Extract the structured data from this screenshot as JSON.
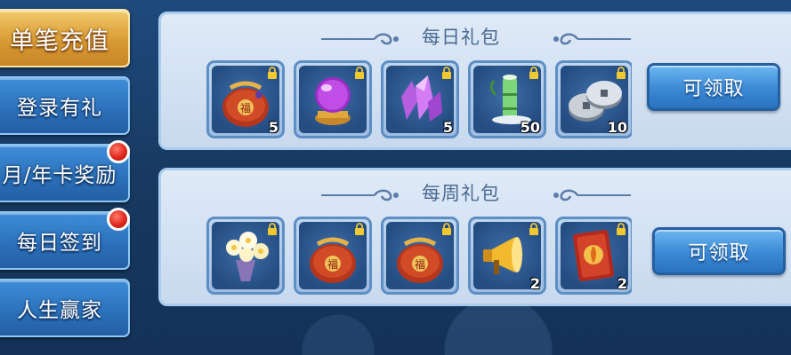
{
  "tabs": [
    {
      "label": "单笔充值",
      "active": true,
      "badge": false
    },
    {
      "label": "登录有礼",
      "active": false,
      "badge": false
    },
    {
      "label": "月/年卡奖励",
      "active": false,
      "badge": true
    },
    {
      "label": "每日签到",
      "active": false,
      "badge": true
    },
    {
      "label": "人生赢家",
      "active": false,
      "badge": false
    }
  ],
  "daily_pack": {
    "title": "每日礼包",
    "claim_label": "可领取",
    "items": [
      {
        "icon": "lucky-bag-icon",
        "qty": "5"
      },
      {
        "icon": "crystal-ball-icon",
        "qty": ""
      },
      {
        "icon": "purple-crystal-icon",
        "qty": "5"
      },
      {
        "icon": "bamboo-icon",
        "qty": "50"
      },
      {
        "icon": "silver-coins-icon",
        "qty": "10"
      }
    ]
  },
  "weekly_pack": {
    "title": "每周礼包",
    "claim_label": "可领取",
    "items": [
      {
        "icon": "flower-bouquet-icon",
        "qty": ""
      },
      {
        "icon": "lucky-bag-icon",
        "qty": ""
      },
      {
        "icon": "lucky-bag-icon",
        "qty": ""
      },
      {
        "icon": "megaphone-icon",
        "qty": "2"
      },
      {
        "icon": "red-card-icon",
        "qty": "2"
      }
    ]
  },
  "colors": {
    "tab_active": "#d89b34",
    "tab": "#2b6fb9",
    "badge": "#e0271d",
    "panel": "#dfeaf7"
  }
}
